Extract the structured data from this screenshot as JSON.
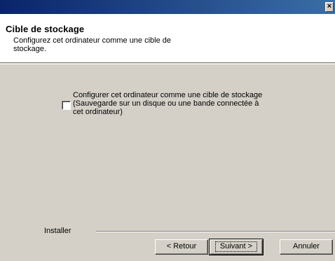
{
  "window": {
    "close_glyph": "×"
  },
  "header": {
    "title": "Cible de stockage",
    "description": "Configurez cet ordinateur comme une cible de stockage."
  },
  "option": {
    "checked": false,
    "label": "Configurer cet ordinateur comme une cible de stockage (Sauvegarde sur un disque ou une bande connectée à cet ordinateur)"
  },
  "footer": {
    "group_label": "Installer",
    "back_label": "< Retour",
    "next_label": "Suivant >",
    "cancel_label": "Annuler"
  }
}
